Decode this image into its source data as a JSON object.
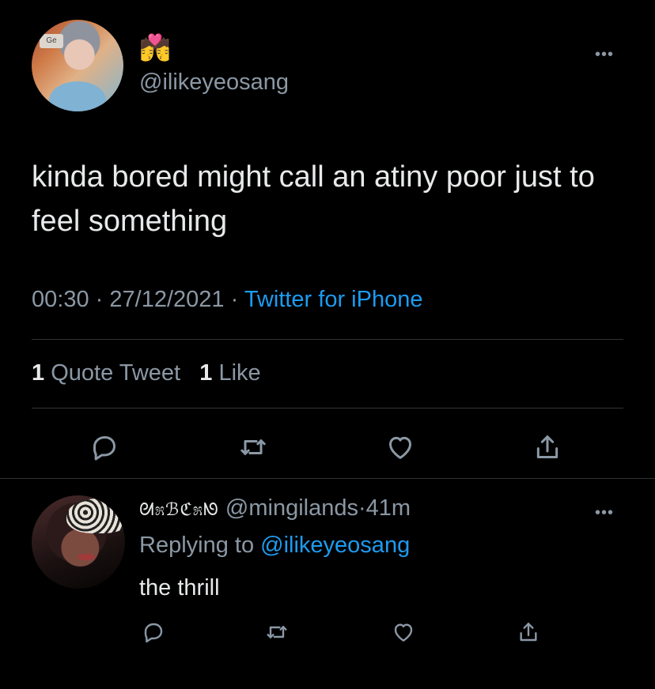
{
  "main_tweet": {
    "author_emoji": "💏",
    "handle": "@ilikeyeosang",
    "text": "kinda bored might call an atiny poor just to feel something",
    "time": "00:30",
    "separator": "·",
    "date": "27/12/2021",
    "source": "Twitter for iPhone",
    "quote_count": "1",
    "quote_label": "Quote Tweet",
    "like_count": "1",
    "like_label": "Like",
    "more_label": "•••"
  },
  "reply": {
    "display_name_deco": "ᘛ೫ℬℭ೫ᘚ",
    "handle": "@mingilands",
    "separator": "·",
    "age": "41m",
    "replying_prefix": "Replying to",
    "replying_to": "@ilikeyeosang",
    "text": "the thrill",
    "more_label": "•••"
  },
  "colors": {
    "background": "#000000",
    "text_primary": "#e7e9ea",
    "text_secondary": "#8b98a5",
    "accent": "#1d9bf0",
    "divider": "#2f3336"
  },
  "icons": [
    "reply-icon",
    "retweet-icon",
    "like-icon",
    "share-icon",
    "more-icon"
  ]
}
